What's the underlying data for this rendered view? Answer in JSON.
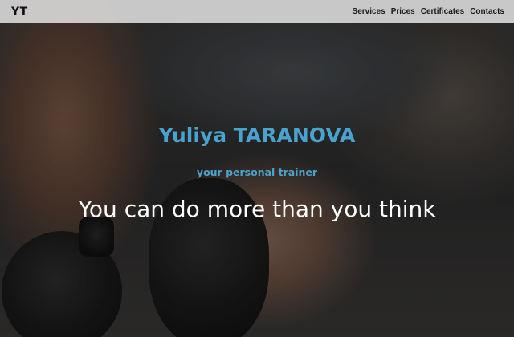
{
  "navbar": {
    "brand": "YT",
    "links": [
      {
        "label": "Services"
      },
      {
        "label": "Prices"
      },
      {
        "label": "Certificates"
      },
      {
        "label": "Contacts"
      }
    ]
  },
  "hero": {
    "name": "Yuliya TARANOVA",
    "subtitle": "your personal trainer",
    "tagline": "You can do more than you think",
    "image_description": "hero-background-photo"
  },
  "colors": {
    "accent": "#4aa3cf",
    "tagline": "#ffffff",
    "navbar_bg": "#ebebeb"
  }
}
